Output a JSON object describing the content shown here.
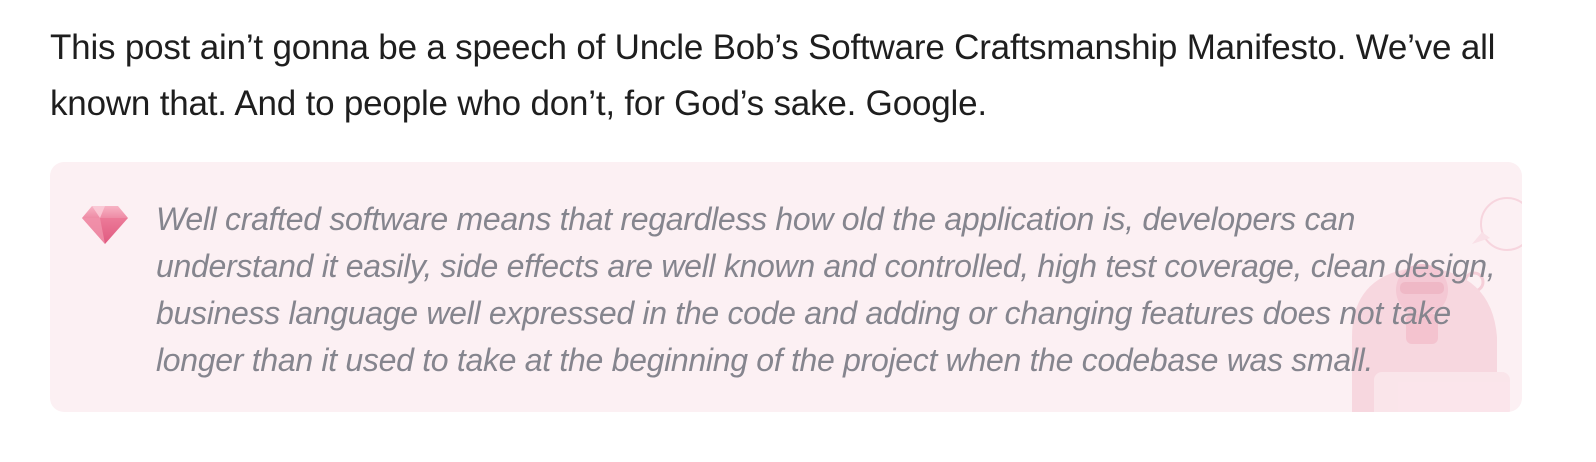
{
  "article": {
    "intro_paragraph": "This post ain’t gonna be a speech of Uncle Bob’s Software Craftsmanship Manifesto. We’ve all known that. And to people who don’t, for God’s sake. Google.",
    "callout": {
      "icon": "gem-icon",
      "quote": "Well crafted software means that regardless how old the application is, developers can understand it easily, side effects are well known and controlled, high test coverage, clean design, business language well expressed in the code and adding or changing features does not take longer than it used to take at the beginning of the project when the codebase was small.",
      "background_color": "#fcf0f3",
      "text_color": "#85858e",
      "accent_color": "#e86a8a"
    }
  }
}
